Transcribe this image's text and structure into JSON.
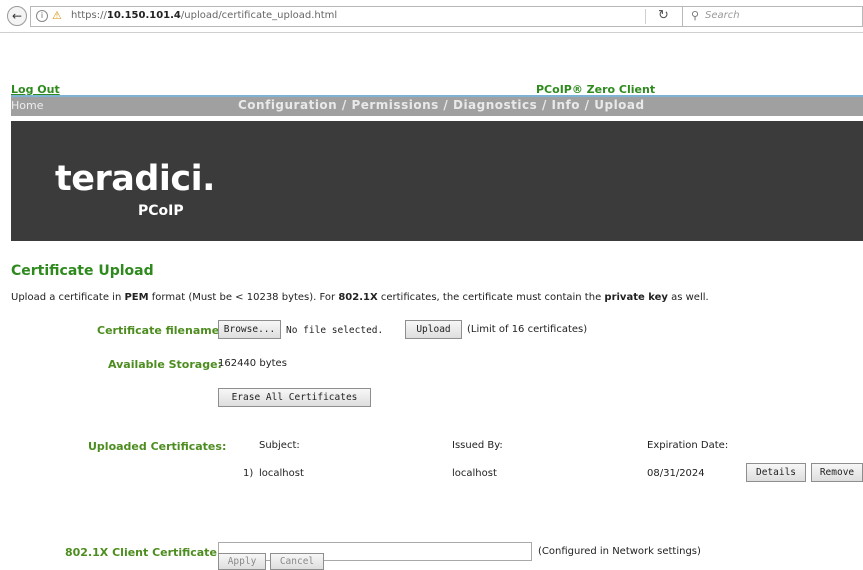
{
  "browser": {
    "url_prefix": "https://",
    "url_host": "10.150.101.4",
    "url_path": "/upload/certificate_upload.html",
    "search_placeholder": "Search",
    "icons": {
      "back": "back-arrow-icon",
      "info": "info-icon",
      "lock": "lock-warning-icon",
      "reload": "reload-icon",
      "search": "search-icon"
    }
  },
  "header": {
    "logout": "Log Out",
    "product": "PCoIP® Zero Client",
    "home": "Home",
    "nav_links": "Configuration / Permissions / Diagnostics / Info / Upload"
  },
  "banner": {
    "logo_main": "teradici",
    "logo_dot": ".",
    "logo_sub": "PCoIP"
  },
  "page": {
    "title": "Certificate Upload",
    "intro_1": "Upload a certificate in ",
    "intro_pem": "PEM",
    "intro_2": " format (Must be < 10238 bytes). For ",
    "intro_8021x": "802.1X",
    "intro_3": " certificates, the certificate must contain the ",
    "intro_private": "private key",
    "intro_4": " as well."
  },
  "form": {
    "filename_label": "Certificate filename:",
    "browse_button": "Browse...",
    "no_file": "No file selected.",
    "upload_button": "Upload",
    "limit_text": "(Limit of 16 certificates)",
    "storage_label": "Available Storage:",
    "storage_value": "162440 bytes",
    "erase_button": "Erase All Certificates",
    "uploaded_label": "Uploaded Certificates:",
    "col_subject": "Subject:",
    "col_issued": "Issued By:",
    "col_expiration": "Expiration Date:",
    "certs": [
      {
        "index": "1)",
        "subject": "localhost",
        "issued_by": "localhost",
        "expiration": "08/31/2024",
        "details_button": "Details",
        "remove_button": "Remove"
      }
    ],
    "client_cert_label": "802.1X Client Certificate:",
    "client_cert_value": "",
    "client_cert_note": "(Configured in Network settings)",
    "apply_button": "Apply",
    "cancel_button": "Cancel"
  },
  "colors": {
    "accent_green": "#2f8a1e",
    "label_green": "#4d8d1f",
    "nav_gray": "#a0a0a0",
    "banner_dark": "#3b3b3b"
  }
}
